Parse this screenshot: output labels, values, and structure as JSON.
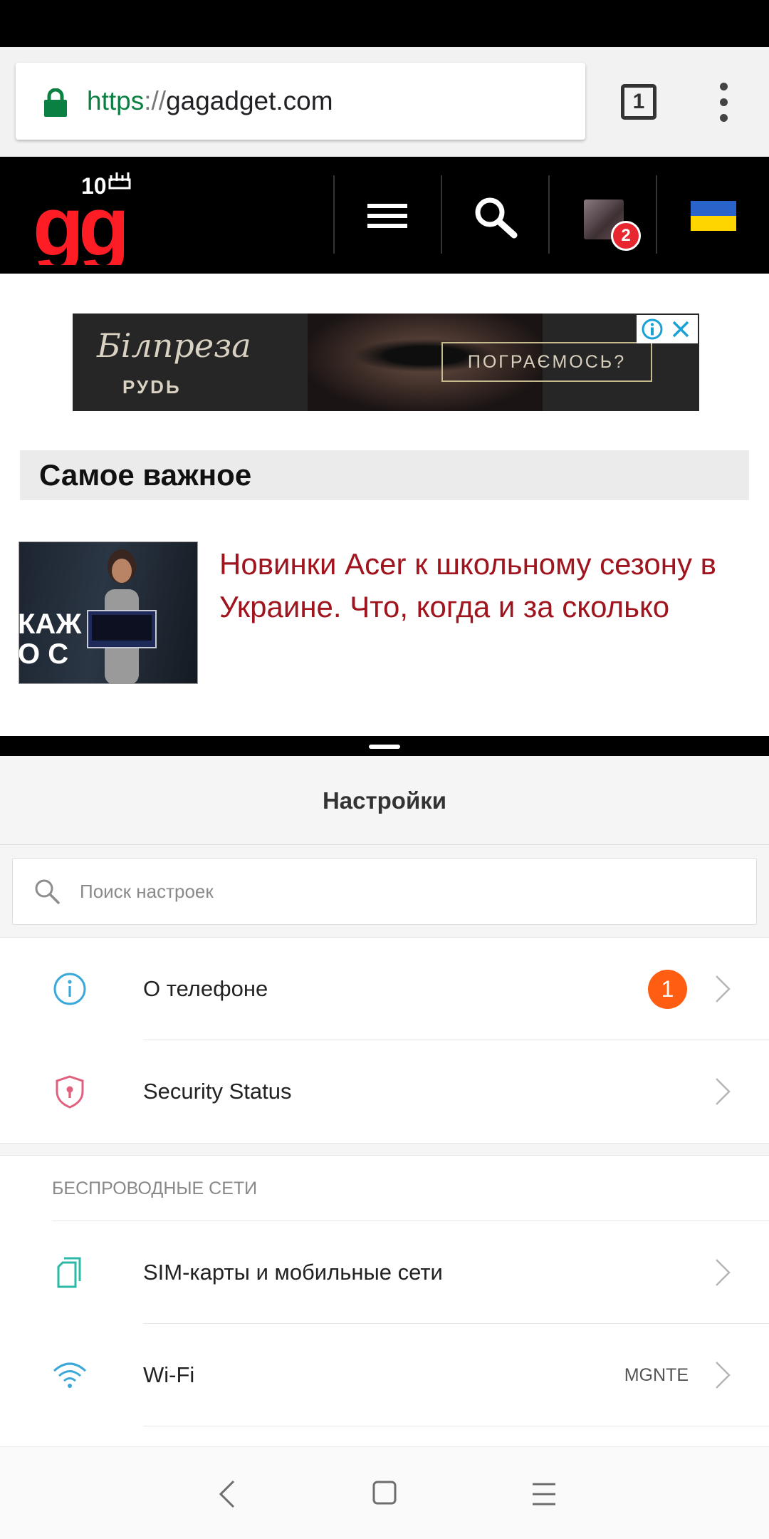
{
  "browser": {
    "url_scheme": "https",
    "url_separator": "://",
    "url_host": "gagadget.com",
    "tab_count": "1"
  },
  "site": {
    "logo_text": "gg",
    "logo_badge": "10",
    "notification_count": "2"
  },
  "ad": {
    "brand_script": "Білпреза",
    "brand_sub": "РУDЬ",
    "cta_label": "ПОГРАЄМОСЬ?"
  },
  "section": {
    "title": "Самое важное"
  },
  "article": {
    "title": "Новинки Acer к школьному сезону в Украине. Что, когда и за сколько",
    "thumb_text": "КАЖ\nО С"
  },
  "settings": {
    "title": "Настройки",
    "search_placeholder": "Поиск настроек",
    "rows_top": [
      {
        "label": "О телефоне",
        "badge": "1"
      },
      {
        "label": "Security Status"
      }
    ],
    "wireless_header": "БЕСПРОВОДНЫЕ СЕТИ",
    "rows_wireless": [
      {
        "label": "SIM-карты и мобильные сети"
      },
      {
        "label": "Wi-Fi",
        "value": "MGNTE"
      }
    ]
  },
  "colors": {
    "url_scheme_green": "#0b8043",
    "article_red": "#a0141e",
    "badge_orange": "#fe5d12",
    "icon_blue": "#3aa8d8",
    "icon_pink": "#e0607e",
    "icon_teal": "#2bb8a6",
    "logo_red": "#ff1d25"
  }
}
